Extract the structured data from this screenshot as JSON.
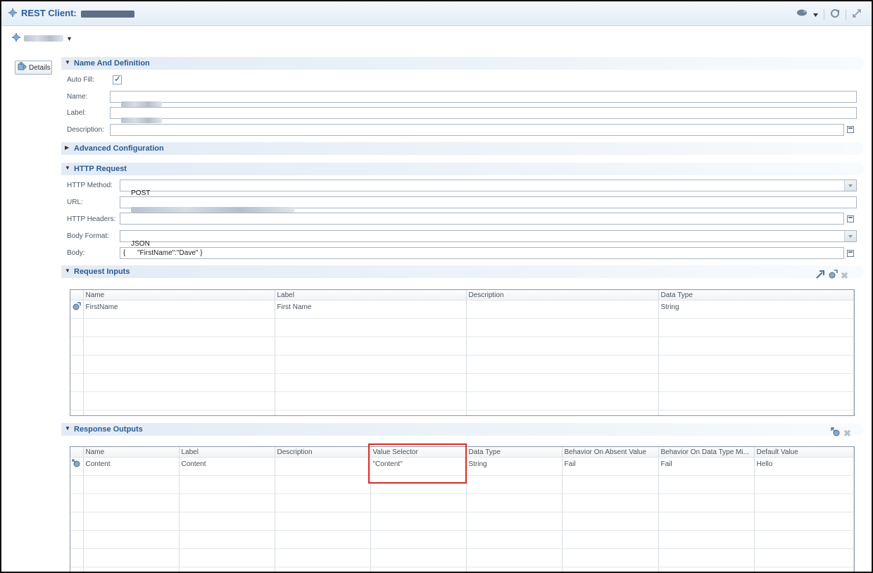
{
  "window": {
    "title": "REST Client:",
    "icons": [
      "rest-client-icon",
      "comment-icon",
      "dropdown-arrow-icon",
      "refresh-icon",
      "arrows-icon"
    ]
  },
  "details_button": {
    "label": "Details",
    "icon": "puzzle-icon"
  },
  "sections": {
    "name_definition": {
      "title": "Name And Definition",
      "auto_fill_label": "Auto Fill:",
      "auto_fill_checked": true,
      "name_label": "Name:",
      "label_label": "Label:",
      "description_label": "Description:",
      "description_value": ""
    },
    "advanced": {
      "title": "Advanced Configuration"
    },
    "http_request": {
      "title": "HTTP Request",
      "method_label": "HTTP Method:",
      "method_value": "POST",
      "url_label": "URL:",
      "headers_label": "HTTP Headers:",
      "headers_value": "",
      "body_format_label": "Body Format:",
      "body_format_value": "JSON",
      "body_label": "Body:",
      "body_value": "{      \"FirstName\":\"Dave\" }"
    },
    "request_inputs": {
      "title": "Request Inputs",
      "columns": [
        "Name",
        "Label",
        "Description",
        "Data Type"
      ],
      "rows": [
        {
          "name": "FirstName",
          "label": "First Name",
          "description": "",
          "data_type": "String"
        }
      ]
    },
    "response_outputs": {
      "title": "Response Outputs",
      "columns": [
        "Name",
        "Label",
        "Description",
        "Value Selector",
        "Data Type",
        "Behavior On Absent Value",
        "Behavior On Data Type Mi...",
        "Default Value"
      ],
      "rows": [
        {
          "name": "Content",
          "label": "Content",
          "description": "",
          "value_selector": "\"Content\"",
          "data_type": "String",
          "absent": "Fail",
          "mismatch": "Fail",
          "default": "Hello"
        }
      ]
    }
  },
  "colors": {
    "highlight": "#d52b2b",
    "section_title": "#2d5b8f"
  }
}
